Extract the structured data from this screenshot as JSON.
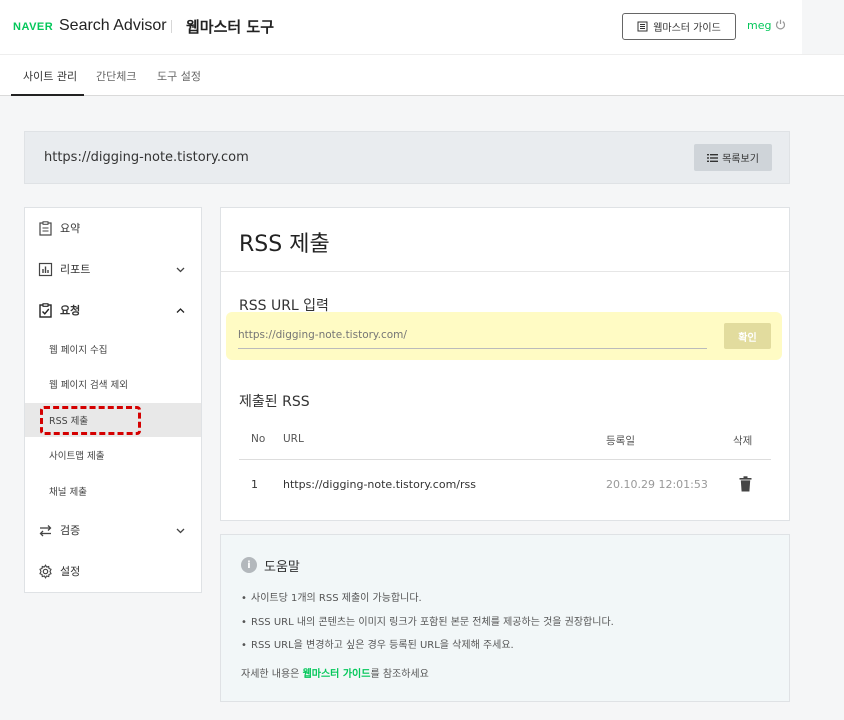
{
  "header": {
    "brand": "NAVER",
    "product": "Search Advisor",
    "tool_title": "웹마스터 도구",
    "guide_button": "웹마스터 가이드",
    "user": "meg",
    "icons": {
      "guide": "book-icon",
      "logout": "power-icon"
    },
    "brand_color": "#03c75a"
  },
  "tabs": [
    {
      "label": "사이트 관리",
      "active": true
    },
    {
      "label": "간단체크",
      "active": false
    },
    {
      "label": "도구 설정",
      "active": false
    }
  ],
  "site": {
    "url": "https://digging-note.tistory.com",
    "list_button": "목록보기"
  },
  "sidebar": {
    "items": [
      {
        "label": "요약",
        "icon": "clipboard-icon"
      },
      {
        "label": "리포트",
        "icon": "bar-chart-icon",
        "expand": "chevron-down-icon"
      },
      {
        "label": "요청",
        "icon": "check-clipboard-icon",
        "expand": "chevron-up-icon",
        "expanded": true
      },
      {
        "label": "검증",
        "icon": "swap-arrows-icon",
        "expand": "chevron-down-icon"
      },
      {
        "label": "설정",
        "icon": "gear-icon"
      }
    ],
    "sub_items": [
      {
        "label": "웹 페이지 수집"
      },
      {
        "label": "웹 페이지 검색 제외"
      },
      {
        "label": "RSS 제출",
        "active": true
      },
      {
        "label": "사이트맵 제출"
      },
      {
        "label": "채널 제출"
      }
    ]
  },
  "main": {
    "title": "RSS 제출",
    "input_section_label": "RSS URL 입력",
    "input_placeholder": "https://digging-note.tistory.com/",
    "confirm_button": "확인",
    "submitted_label": "제출된 RSS",
    "table": {
      "headers": [
        "No",
        "URL",
        "등록일",
        "삭제"
      ],
      "rows": [
        {
          "no": "1",
          "url": "https://digging-note.tistory.com/rss",
          "date": "20.10.29 12:01:53",
          "delete_icon": "trash-icon"
        }
      ]
    },
    "highlight_color": "#fffbc4"
  },
  "help": {
    "title": "도움말",
    "icon": "info-icon",
    "items": [
      "사이트당 1개의 RSS 제출이 가능합니다.",
      "RSS URL 내의 콘텐츠는 이미지 링크가 포함된 본문 전체를 제공하는 것을 권장합니다.",
      "RSS URL을 변경하고 싶은 경우 등록된 URL을 삭제해 주세요."
    ],
    "footer_prefix": "자세한 내용은 ",
    "footer_link": "웹마스터 가이드",
    "footer_suffix": "를 참조하세요"
  }
}
